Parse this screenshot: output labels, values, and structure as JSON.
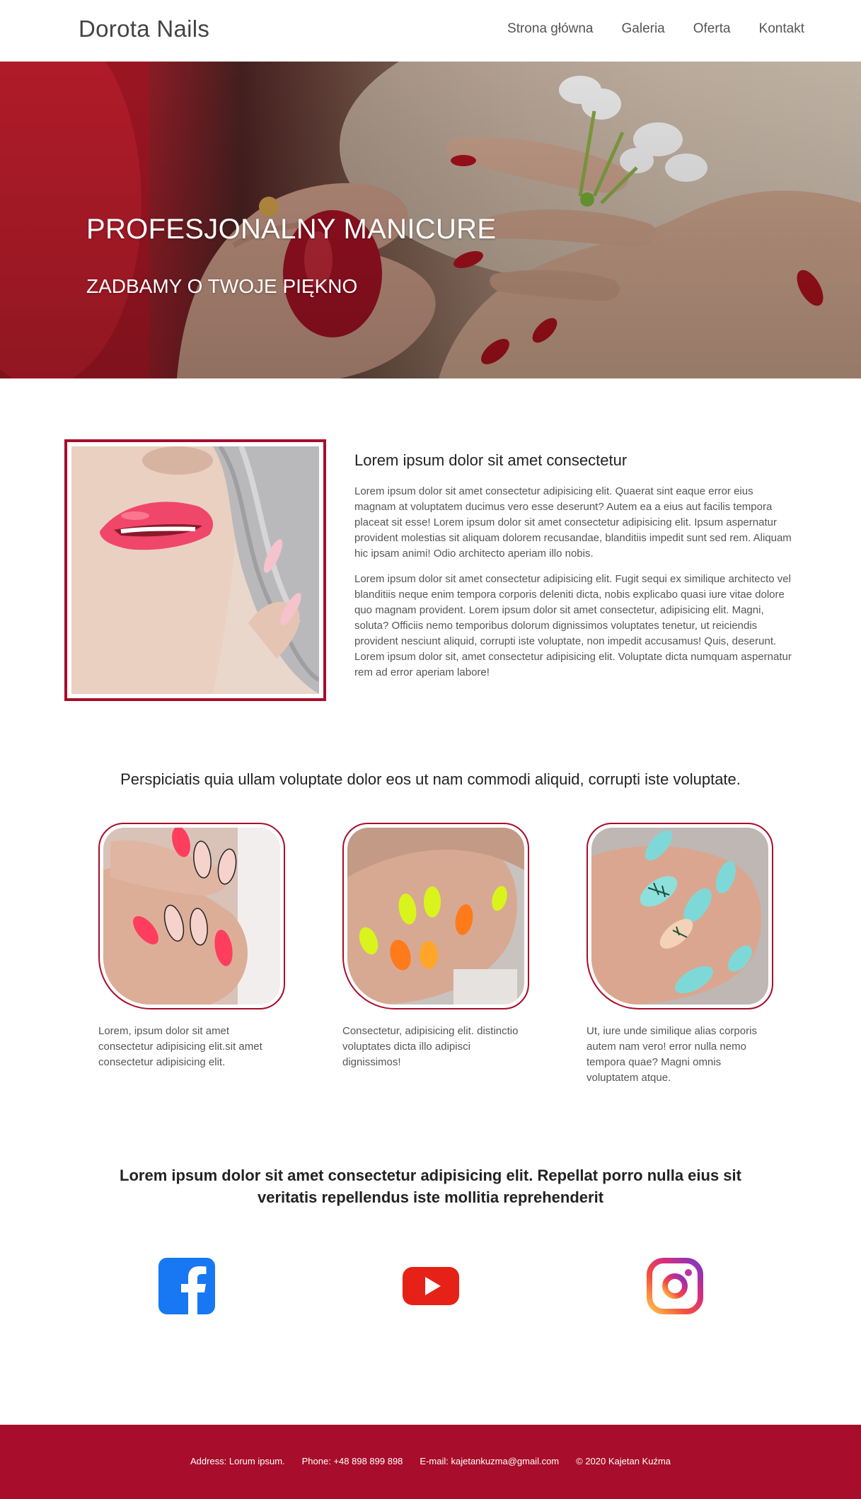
{
  "nav": {
    "brand": "Dorota Nails",
    "links": [
      "Strona główna",
      "Galeria",
      "Oferta",
      "Kontakt"
    ]
  },
  "hero": {
    "title": "PROFESJONALNY MANICURE",
    "subtitle": "ZADBAMY O TWOJE PIĘKNO"
  },
  "about": {
    "heading": "Lorem ipsum dolor sit amet consectetur",
    "paragraphs": [
      "Lorem ipsum dolor sit amet consectetur adipisicing elit. Quaerat sint eaque error eius magnam at voluptatem ducimus vero esse deserunt? Autem ea a eius aut facilis tempora placeat sit esse! Lorem ipsum dolor sit amet consectetur adipisicing elit. Ipsum aspernatur provident molestias sit aliquam dolorem recusandae, blanditiis impedit sunt sed rem. Aliquam hic ipsam animi! Odio architecto aperiam illo nobis.",
      "Lorem ipsum dolor sit amet consectetur adipisicing elit. Fugit sequi ex similique architecto vel blanditiis neque enim tempora corporis deleniti dicta, nobis explicabo quasi iure vitae dolore quo magnam provident. Lorem ipsum dolor sit amet consectetur, adipisicing elit. Magni, soluta? Officiis nemo temporibus dolorum dignissimos voluptates tenetur, ut reiciendis provident nesciunt aliquid, corrupti iste voluptate, non impedit accusamus! Quis, deserunt. Lorem ipsum dolor sit, amet consectetur adipisicing elit. Voluptate dicta numquam aspernatur rem ad error aperiam labore!"
    ]
  },
  "gallery": {
    "heading": "Perspiciatis quia ullam voluptate dolor eos ut nam commodi aliquid, corrupti iste voluptate.",
    "cards": [
      {
        "text": "Lorem, ipsum dolor sit amet consectetur adipisicing elit.sit amet consectetur adipisicing elit."
      },
      {
        "text": "Consectetur, adipisicing elit. distinctio voluptates dicta illo adipisci dignissimos!"
      },
      {
        "text": "Ut, iure unde similique alias corporis autem nam vero! error nulla nemo tempora quae? Magni omnis voluptatem atque."
      }
    ]
  },
  "social": {
    "heading": "Lorem ipsum dolor sit amet consectetur adipisicing elit. Repellat porro nulla eius sit veritatis repellendus iste mollitia reprehenderit",
    "icons": [
      "facebook-icon",
      "youtube-icon",
      "instagram-icon"
    ],
    "colors": {
      "facebook": "#1877f2",
      "youtube": "#e62117",
      "instagram": "#c13584"
    }
  },
  "footer": {
    "address": "Address: Lorum ipsum.",
    "phone": "Phone: +48 898 899 898",
    "email": "E-mail: kajetankuzma@gmail.com",
    "copyright": "© 2020 Kajetan Kuźma"
  },
  "colors": {
    "accent": "#a80d2b",
    "footer_bg": "#a80d2b"
  }
}
